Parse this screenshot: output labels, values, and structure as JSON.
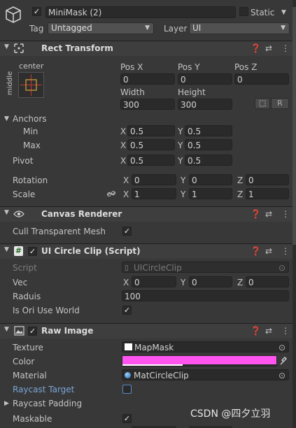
{
  "header": {
    "object_name": "MiniMask (2)",
    "static_label": "Static",
    "tag_label": "Tag",
    "tag_value": "Untagged",
    "layer_label": "Layer",
    "layer_value": "UI"
  },
  "rect_transform": {
    "title": "Rect Transform",
    "anchor_preset_h": "center",
    "anchor_preset_v": "middle",
    "pos_x_label": "Pos X",
    "pos_y_label": "Pos Y",
    "pos_z_label": "Pos Z",
    "pos_x": "0",
    "pos_y": "0",
    "pos_z": "0",
    "width_label": "Width",
    "height_label": "Height",
    "width": "300",
    "height": "300",
    "r_button": "R",
    "anchors_label": "Anchors",
    "min_label": "Min",
    "min_x": "0.5",
    "min_y": "0.5",
    "max_label": "Max",
    "max_x": "0.5",
    "max_y": "0.5",
    "pivot_label": "Pivot",
    "pivot_x": "0.5",
    "pivot_y": "0.5",
    "rotation_label": "Rotation",
    "rot_x": "0",
    "rot_y": "0",
    "rot_z": "0",
    "scale_label": "Scale",
    "scale_x": "1",
    "scale_y": "1",
    "scale_z": "1",
    "axis_x": "X",
    "axis_y": "Y",
    "axis_z": "Z"
  },
  "canvas_renderer": {
    "title": "Canvas Renderer",
    "cull_label": "Cull Transparent Mesh"
  },
  "circle_clip": {
    "title": "UI Circle Clip (Script)",
    "script_label": "Script",
    "script_value": "UICircleClip",
    "vec_label": "Vec",
    "vec_x": "0",
    "vec_y": "0",
    "vec_z": "0",
    "raduis_label": "Raduis",
    "raduis_value": "100",
    "world_label": "Is Ori Use World"
  },
  "raw_image": {
    "title": "Raw Image",
    "texture_label": "Texture",
    "texture_value": "MapMask",
    "color_label": "Color",
    "color_value": "#ff55ee",
    "material_label": "Material",
    "material_value": "MatCircleClip",
    "raycast_target_label": "Raycast Target",
    "raycast_padding_label": "Raycast Padding",
    "maskable_label": "Maskable"
  },
  "watermark": "CSDN @四夕立羽"
}
